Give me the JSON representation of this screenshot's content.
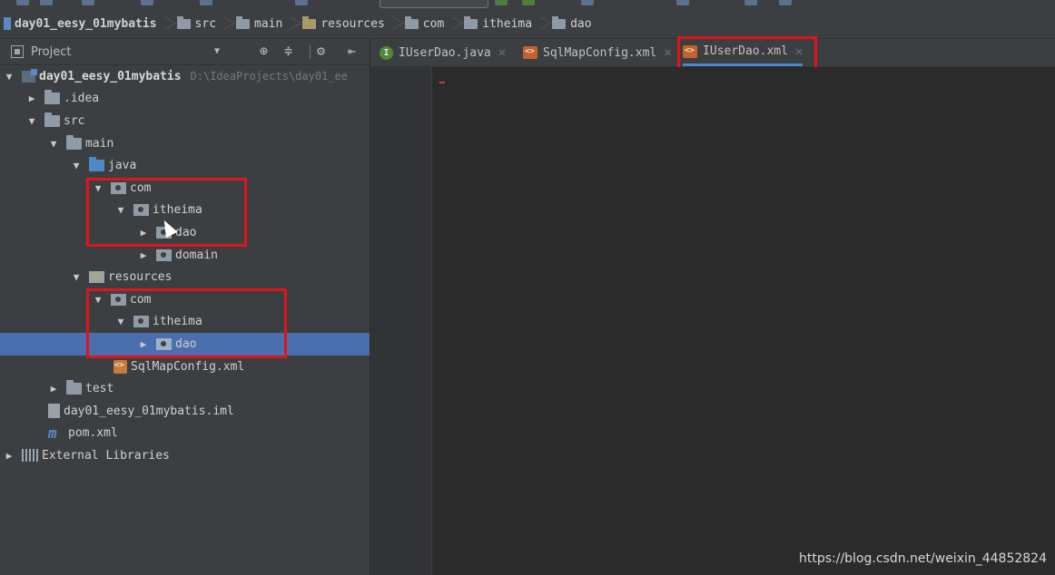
{
  "breadcrumb": [
    {
      "label": "day01_eesy_01mybatis",
      "icon": "project-icon"
    },
    {
      "label": "src",
      "icon": "folder-icon"
    },
    {
      "label": "main",
      "icon": "folder-icon"
    },
    {
      "label": "resources",
      "icon": "resources-folder-icon"
    },
    {
      "label": "com",
      "icon": "package-icon"
    },
    {
      "label": "itheima",
      "icon": "package-icon"
    },
    {
      "label": "dao",
      "icon": "package-icon"
    }
  ],
  "project_panel": {
    "title": "Project",
    "tree": [
      {
        "label": "day01_eesy_01mybatis",
        "hint": "D:\\IdeaProjects\\day01_ee",
        "icon": "module-icon",
        "expanded": true
      },
      {
        "label": ".idea",
        "icon": "folder-icon",
        "expanded": false
      },
      {
        "label": "src",
        "icon": "folder-icon",
        "expanded": true
      },
      {
        "label": "main",
        "icon": "folder-icon",
        "expanded": true
      },
      {
        "label": "java",
        "icon": "source-folder-icon",
        "expanded": true
      },
      {
        "label": "com",
        "icon": "package-icon",
        "expanded": true
      },
      {
        "label": "itheima",
        "icon": "package-icon",
        "expanded": true
      },
      {
        "label": "dao",
        "icon": "package-icon",
        "expanded": false
      },
      {
        "label": "domain",
        "icon": "package-icon",
        "expanded": false
      },
      {
        "label": "resources",
        "icon": "resources-folder-icon",
        "expanded": true
      },
      {
        "label": "com",
        "icon": "package-icon",
        "expanded": true
      },
      {
        "label": "itheima",
        "icon": "package-icon",
        "expanded": true
      },
      {
        "label": "dao",
        "icon": "package-icon",
        "expanded": false,
        "selected": true
      },
      {
        "label": "SqlMapConfig.xml",
        "icon": "xml-file-icon"
      },
      {
        "label": "test",
        "icon": "folder-icon",
        "expanded": false
      },
      {
        "label": "day01_eesy_01mybatis.iml",
        "icon": "iml-file-icon"
      },
      {
        "label": "pom.xml",
        "icon": "maven-icon"
      },
      {
        "label": "External Libraries",
        "icon": "libraries-icon",
        "expanded": false
      }
    ]
  },
  "editor_tabs": [
    {
      "label": "IUserDao.java",
      "icon": "java-interface-icon",
      "active": false
    },
    {
      "label": "SqlMapConfig.xml",
      "icon": "xml-file-icon",
      "active": false
    },
    {
      "label": "IUserDao.xml",
      "icon": "xml-file-icon",
      "active": true
    }
  ],
  "watermark": "https://blog.csdn.net/weixin_44852824",
  "colors": {
    "highlight_box": "#e0141b",
    "selection": "#4b6eaf",
    "active_tab_underline": "#4a88c7"
  }
}
